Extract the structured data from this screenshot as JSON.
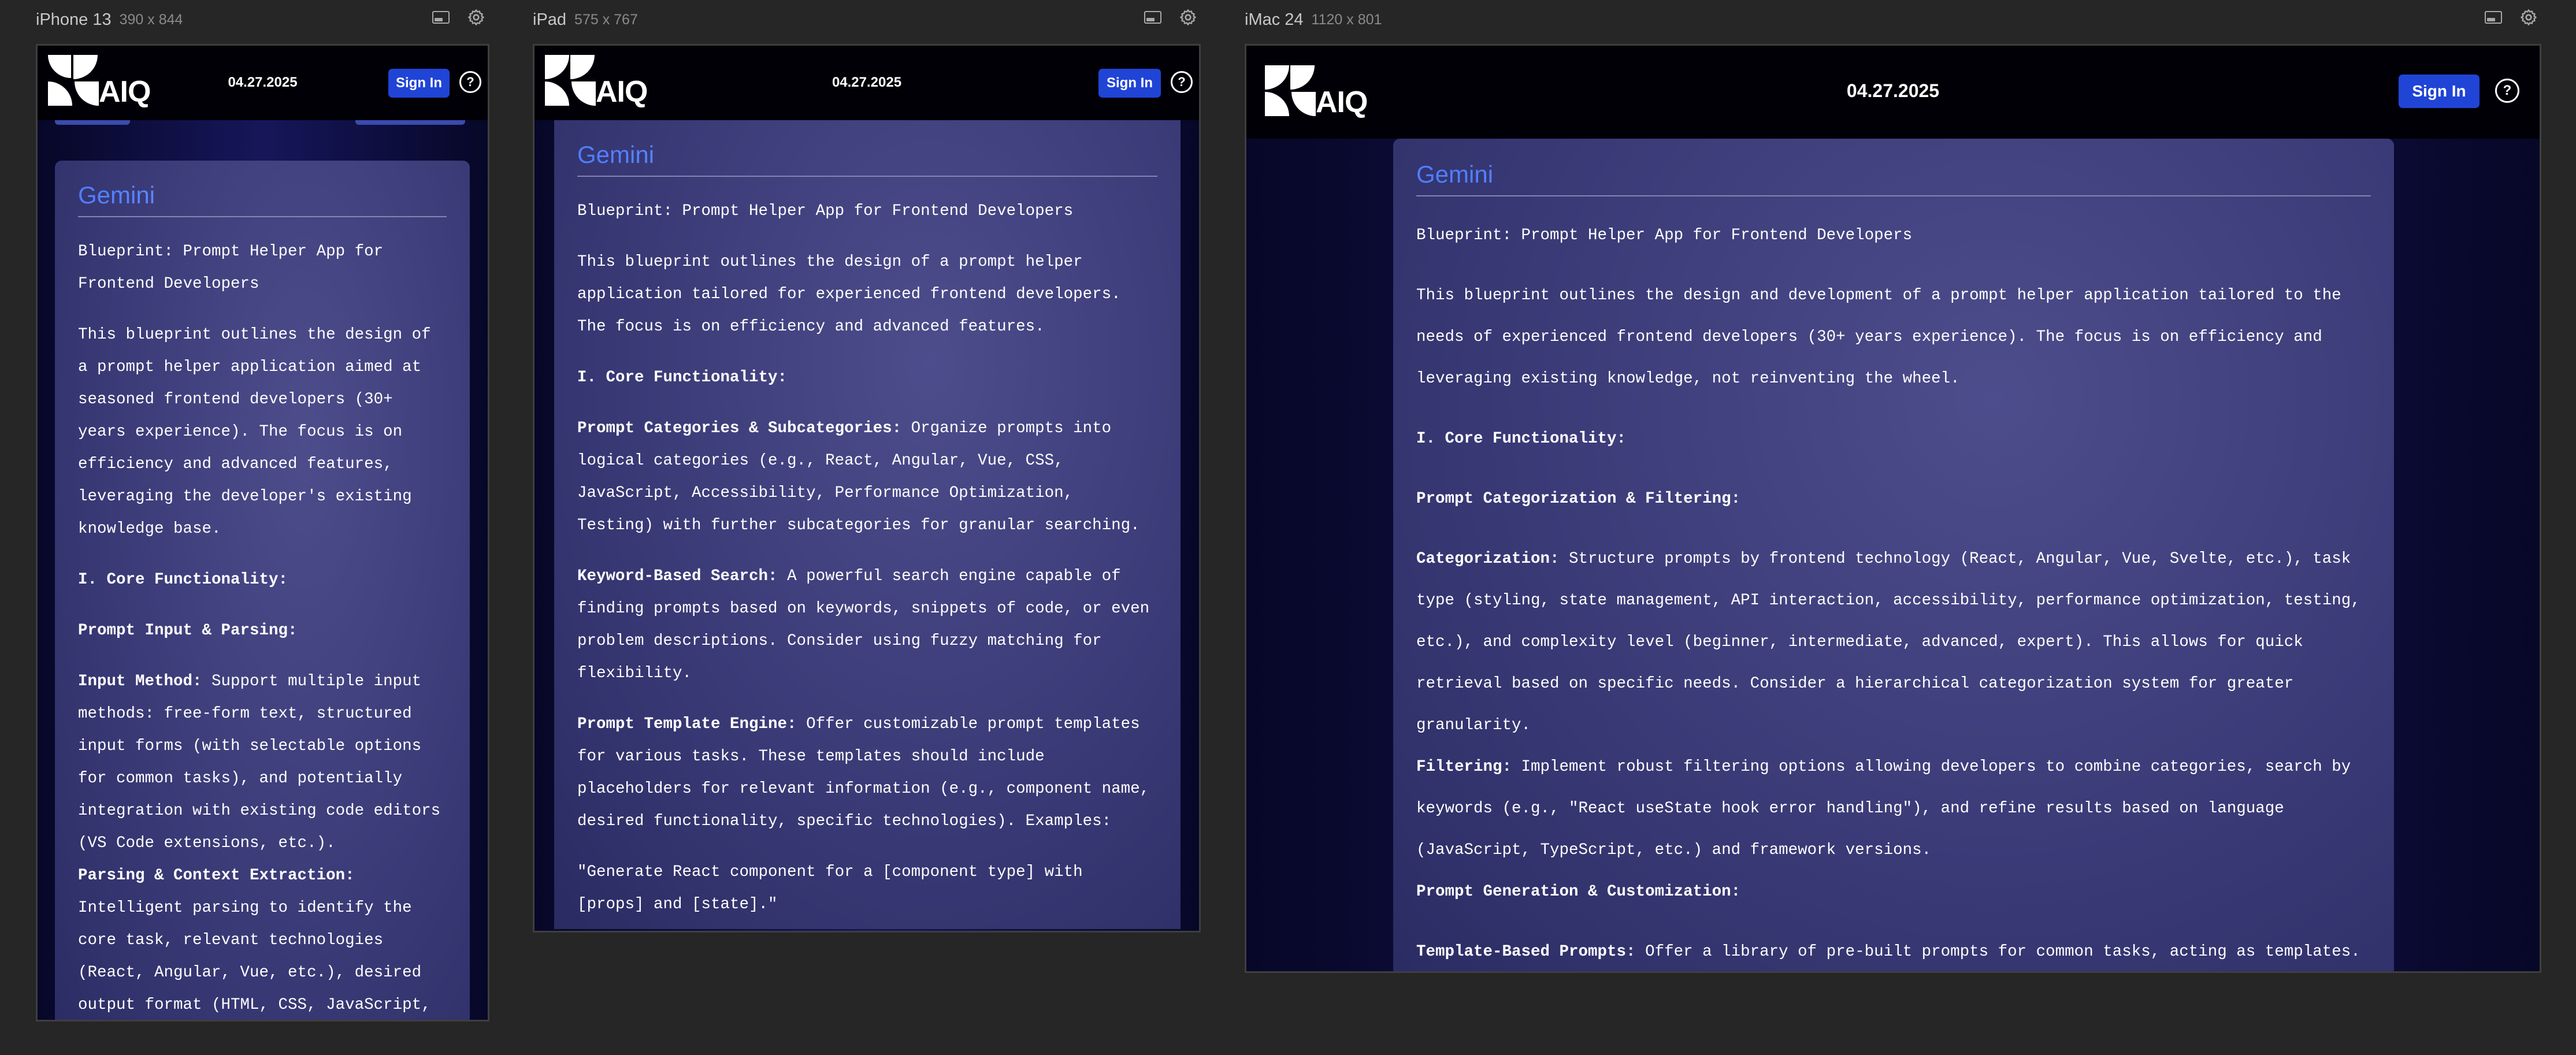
{
  "devices": {
    "phone": {
      "name": "iPhone 13",
      "size": "390 x 844"
    },
    "tablet": {
      "name": "iPad",
      "size": "575 x 767"
    },
    "desktop": {
      "name": "iMac 24",
      "size": "1120 x 801"
    }
  },
  "app": {
    "logo_text": "AIQ",
    "date": "04.27.2025",
    "signin_label": "Sign In",
    "help_glyph": "?",
    "card_brand": "Gemini",
    "colors": {
      "header": "#000006",
      "button": "#2044d6",
      "card": "#3a3a77"
    }
  },
  "phone": {
    "title": "Blueprint: Prompt Helper App for Frontend Developers",
    "intro": "This blueprint outlines the design of a prompt helper application aimed at seasoned frontend developers (30+ years experience). The focus is on efficiency and advanced features, leveraging the developer's existing knowledge base.",
    "section1": "I. Core Functionality:",
    "sub1": "Prompt Input & Parsing:",
    "p1_label": "Input Method:",
    "p1_text": " Support multiple input methods: free-form text, structured input forms (with selectable options for common tasks), and potentially integration with existing code editors (VS Code extensions, etc.).",
    "p2_label": "Parsing & Context Extraction:",
    "p2_text": " Intelligent parsing to identify the core task, relevant technologies (React, Angular, Vue, etc.), desired output format (HTML, CSS, JavaScript, JSON, etc.), and any specific"
  },
  "tablet": {
    "title": "Blueprint: Prompt Helper App for Frontend Developers",
    "intro": "This blueprint outlines the design of a prompt helper application tailored for experienced frontend developers. The focus is on efficiency and advanced features.",
    "section1": "I. Core Functionality:",
    "p1_label": "Prompt Categories & Subcategories:",
    "p1_text": " Organize prompts into logical categories (e.g., React, Angular, Vue, CSS, JavaScript, Accessibility, Performance Optimization, Testing) with further subcategories for granular searching.",
    "p2_label": "Keyword-Based Search:",
    "p2_text": " A powerful search engine capable of finding prompts based on keywords, snippets of code, or even problem descriptions. Consider using fuzzy matching for flexibility.",
    "p3_label": "Prompt Template Engine:",
    "p3_text": " Offer customizable prompt templates for various tasks. These templates should include placeholders for relevant information (e.g., component name, desired functionality, specific technologies). Examples:",
    "example": "\"Generate React component for a [component type] with [props] and [state].\""
  },
  "desktop": {
    "title": "Blueprint: Prompt Helper App for Frontend Developers",
    "intro": "This blueprint outlines the design and development of a prompt helper application tailored to the needs of experienced frontend developers (30+ years experience). The focus is on efficiency and leveraging existing knowledge, not reinventing the wheel.",
    "section1": "I. Core Functionality:",
    "sub1": "Prompt Categorization & Filtering:",
    "p1_label": "Categorization:",
    "p1_text": " Structure prompts by frontend technology (React, Angular, Vue, Svelte, etc.), task type (styling, state management, API interaction, accessibility, performance optimization, testing, etc.), and complexity level (beginner, intermediate, advanced, expert). This allows for quick retrieval based on specific needs. Consider a hierarchical categorization system for greater granularity.",
    "p2_label": "Filtering:",
    "p2_text": " Implement robust filtering options allowing developers to combine categories, search by keywords (e.g., \"React useState hook error handling\"), and refine results based on language (JavaScript, TypeScript, etc.) and framework versions.",
    "sub2": "Prompt Generation & Customization:",
    "p3_label": "Template-Based Prompts:",
    "p3_text": " Offer a library of pre-built prompts for common tasks, acting as templates. These templates should include placeholders that the user can populate with specific details."
  }
}
